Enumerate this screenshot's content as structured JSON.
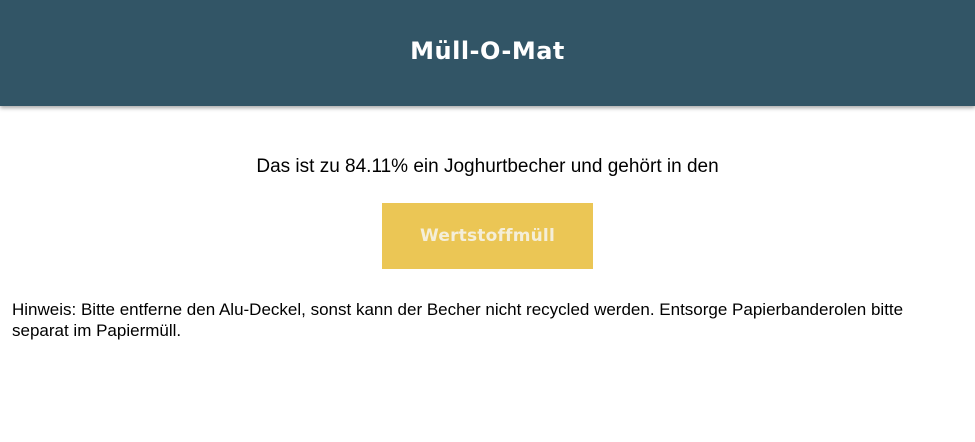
{
  "header": {
    "title": "Müll-O-Mat",
    "background_color": "#325566"
  },
  "result": {
    "text": "Das ist zu 84.11% ein Joghurtbecher und gehört in den",
    "confidence_percent": 84.11,
    "item": "Joghurtbecher"
  },
  "bin": {
    "label": "Wertstoffmüll",
    "color": "#ebc655"
  },
  "hint": {
    "text": "Hinweis: Bitte entferne den Alu-Deckel, sonst kann der Becher nicht recycled werden. Entsorge Papierbanderolen bitte separat im Papiermüll."
  }
}
